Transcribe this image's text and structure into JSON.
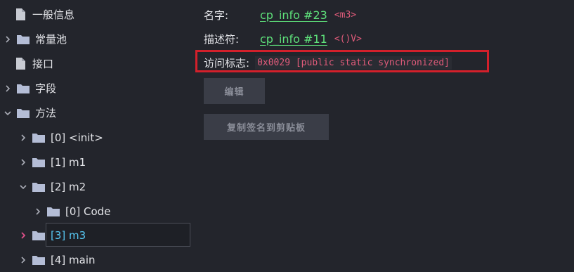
{
  "tree": {
    "items": [
      {
        "label": "一般信息",
        "icon": "document-icon"
      },
      {
        "label": "常量池",
        "icon": "folder-icon",
        "expanded": false
      },
      {
        "label": "接口",
        "icon": "document-icon"
      },
      {
        "label": "字段",
        "icon": "folder-icon",
        "expanded": false
      },
      {
        "label": "方法",
        "icon": "folder-icon",
        "expanded": true
      },
      {
        "label": "[0] <init>",
        "icon": "folder-icon",
        "expanded": false
      },
      {
        "label": "[1] m1",
        "icon": "folder-icon",
        "expanded": false
      },
      {
        "label": "[2] m2",
        "icon": "folder-icon",
        "expanded": true
      },
      {
        "label": "[0] Code",
        "icon": "folder-icon",
        "expanded": false
      },
      {
        "label": "[3] m3",
        "icon": "folder-icon",
        "expanded": false,
        "selected": true
      },
      {
        "label": "[4] main",
        "icon": "folder-icon",
        "expanded": false
      }
    ]
  },
  "details": {
    "name_label": "名字:",
    "name_link": "cp_info #23",
    "name_value": "<m3>",
    "desc_label": "描述符:",
    "desc_link": "cp_info #11",
    "desc_value": "<()V>",
    "flags_label": "访问标志:",
    "flags_value": "0x0029 [public static synchronized]"
  },
  "buttons": {
    "edit": "编辑",
    "copy": "复制签名到剪贴板"
  },
  "colors": {
    "background": "#23252c",
    "link": "#5ee07a",
    "value": "#e05b7a",
    "selected": "#57c7f2",
    "highlight_border": "#d3202b",
    "folder": "#b4bdd6"
  }
}
